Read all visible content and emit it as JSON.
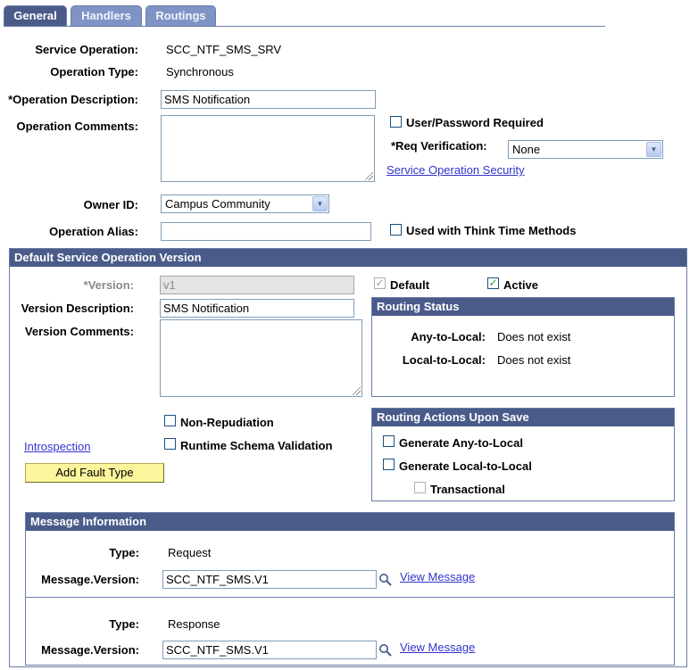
{
  "tabs": [
    {
      "label": "General"
    },
    {
      "label": "Handlers"
    },
    {
      "label": "Routings"
    }
  ],
  "general": {
    "service_operation_label": "Service Operation:",
    "service_operation_value": "SCC_NTF_SMS_SRV",
    "operation_type_label": "Operation Type:",
    "operation_type_value": "Synchronous",
    "operation_description_label": "*Operation Description:",
    "operation_description_value": "SMS Notification",
    "operation_comments_label": "Operation Comments:",
    "operation_comments_value": "",
    "user_password_label": "User/Password Required",
    "user_password_checked": false,
    "req_verification_label": "*Req Verification:",
    "req_verification_value": "None",
    "service_operation_security_link": "Service Operation Security",
    "owner_id_label": "Owner ID:",
    "owner_id_value": "Campus Community",
    "operation_alias_label": "Operation Alias:",
    "operation_alias_value": "",
    "think_time_label": "Used with Think Time Methods",
    "think_time_checked": false
  },
  "version_section": {
    "header": "Default Service Operation Version",
    "version_label": "*Version:",
    "version_value": "v1",
    "default_label": "Default",
    "default_checked": true,
    "active_label": "Active",
    "active_checked": true,
    "version_description_label": "Version Description:",
    "version_description_value": "SMS Notification",
    "version_comments_label": "Version Comments:",
    "version_comments_value": "",
    "non_repudiation_label": "Non-Repudiation",
    "runtime_schema_label": "Runtime Schema Validation",
    "introspection_link": "Introspection",
    "add_fault_type_button": "Add Fault Type",
    "routing_status": {
      "header": "Routing Status",
      "any_to_local_label": "Any-to-Local:",
      "any_to_local_value": "Does not exist",
      "local_to_local_label": "Local-to-Local:",
      "local_to_local_value": "Does not exist"
    },
    "routing_actions": {
      "header": "Routing Actions Upon Save",
      "any_to_local_label": "Generate Any-to-Local",
      "local_to_local_label": "Generate Local-to-Local",
      "transactional_label": "Transactional"
    }
  },
  "message_info": {
    "header": "Message Information",
    "messages": [
      {
        "type_label": "Type:",
        "type_value": "Request",
        "version_label": "Message.Version:",
        "version_value": "SCC_NTF_SMS.V1",
        "view_link": "View Message"
      },
      {
        "type_label": "Type:",
        "type_value": "Response",
        "version_label": "Message.Version:",
        "version_value": "SCC_NTF_SMS.V1",
        "view_link": "View Message"
      }
    ]
  },
  "colors": {
    "header_bg": "#4a5b8a",
    "tab_inactive": "#7f93c5",
    "link": "#3333cc",
    "button_bg": "#fbf59c"
  }
}
